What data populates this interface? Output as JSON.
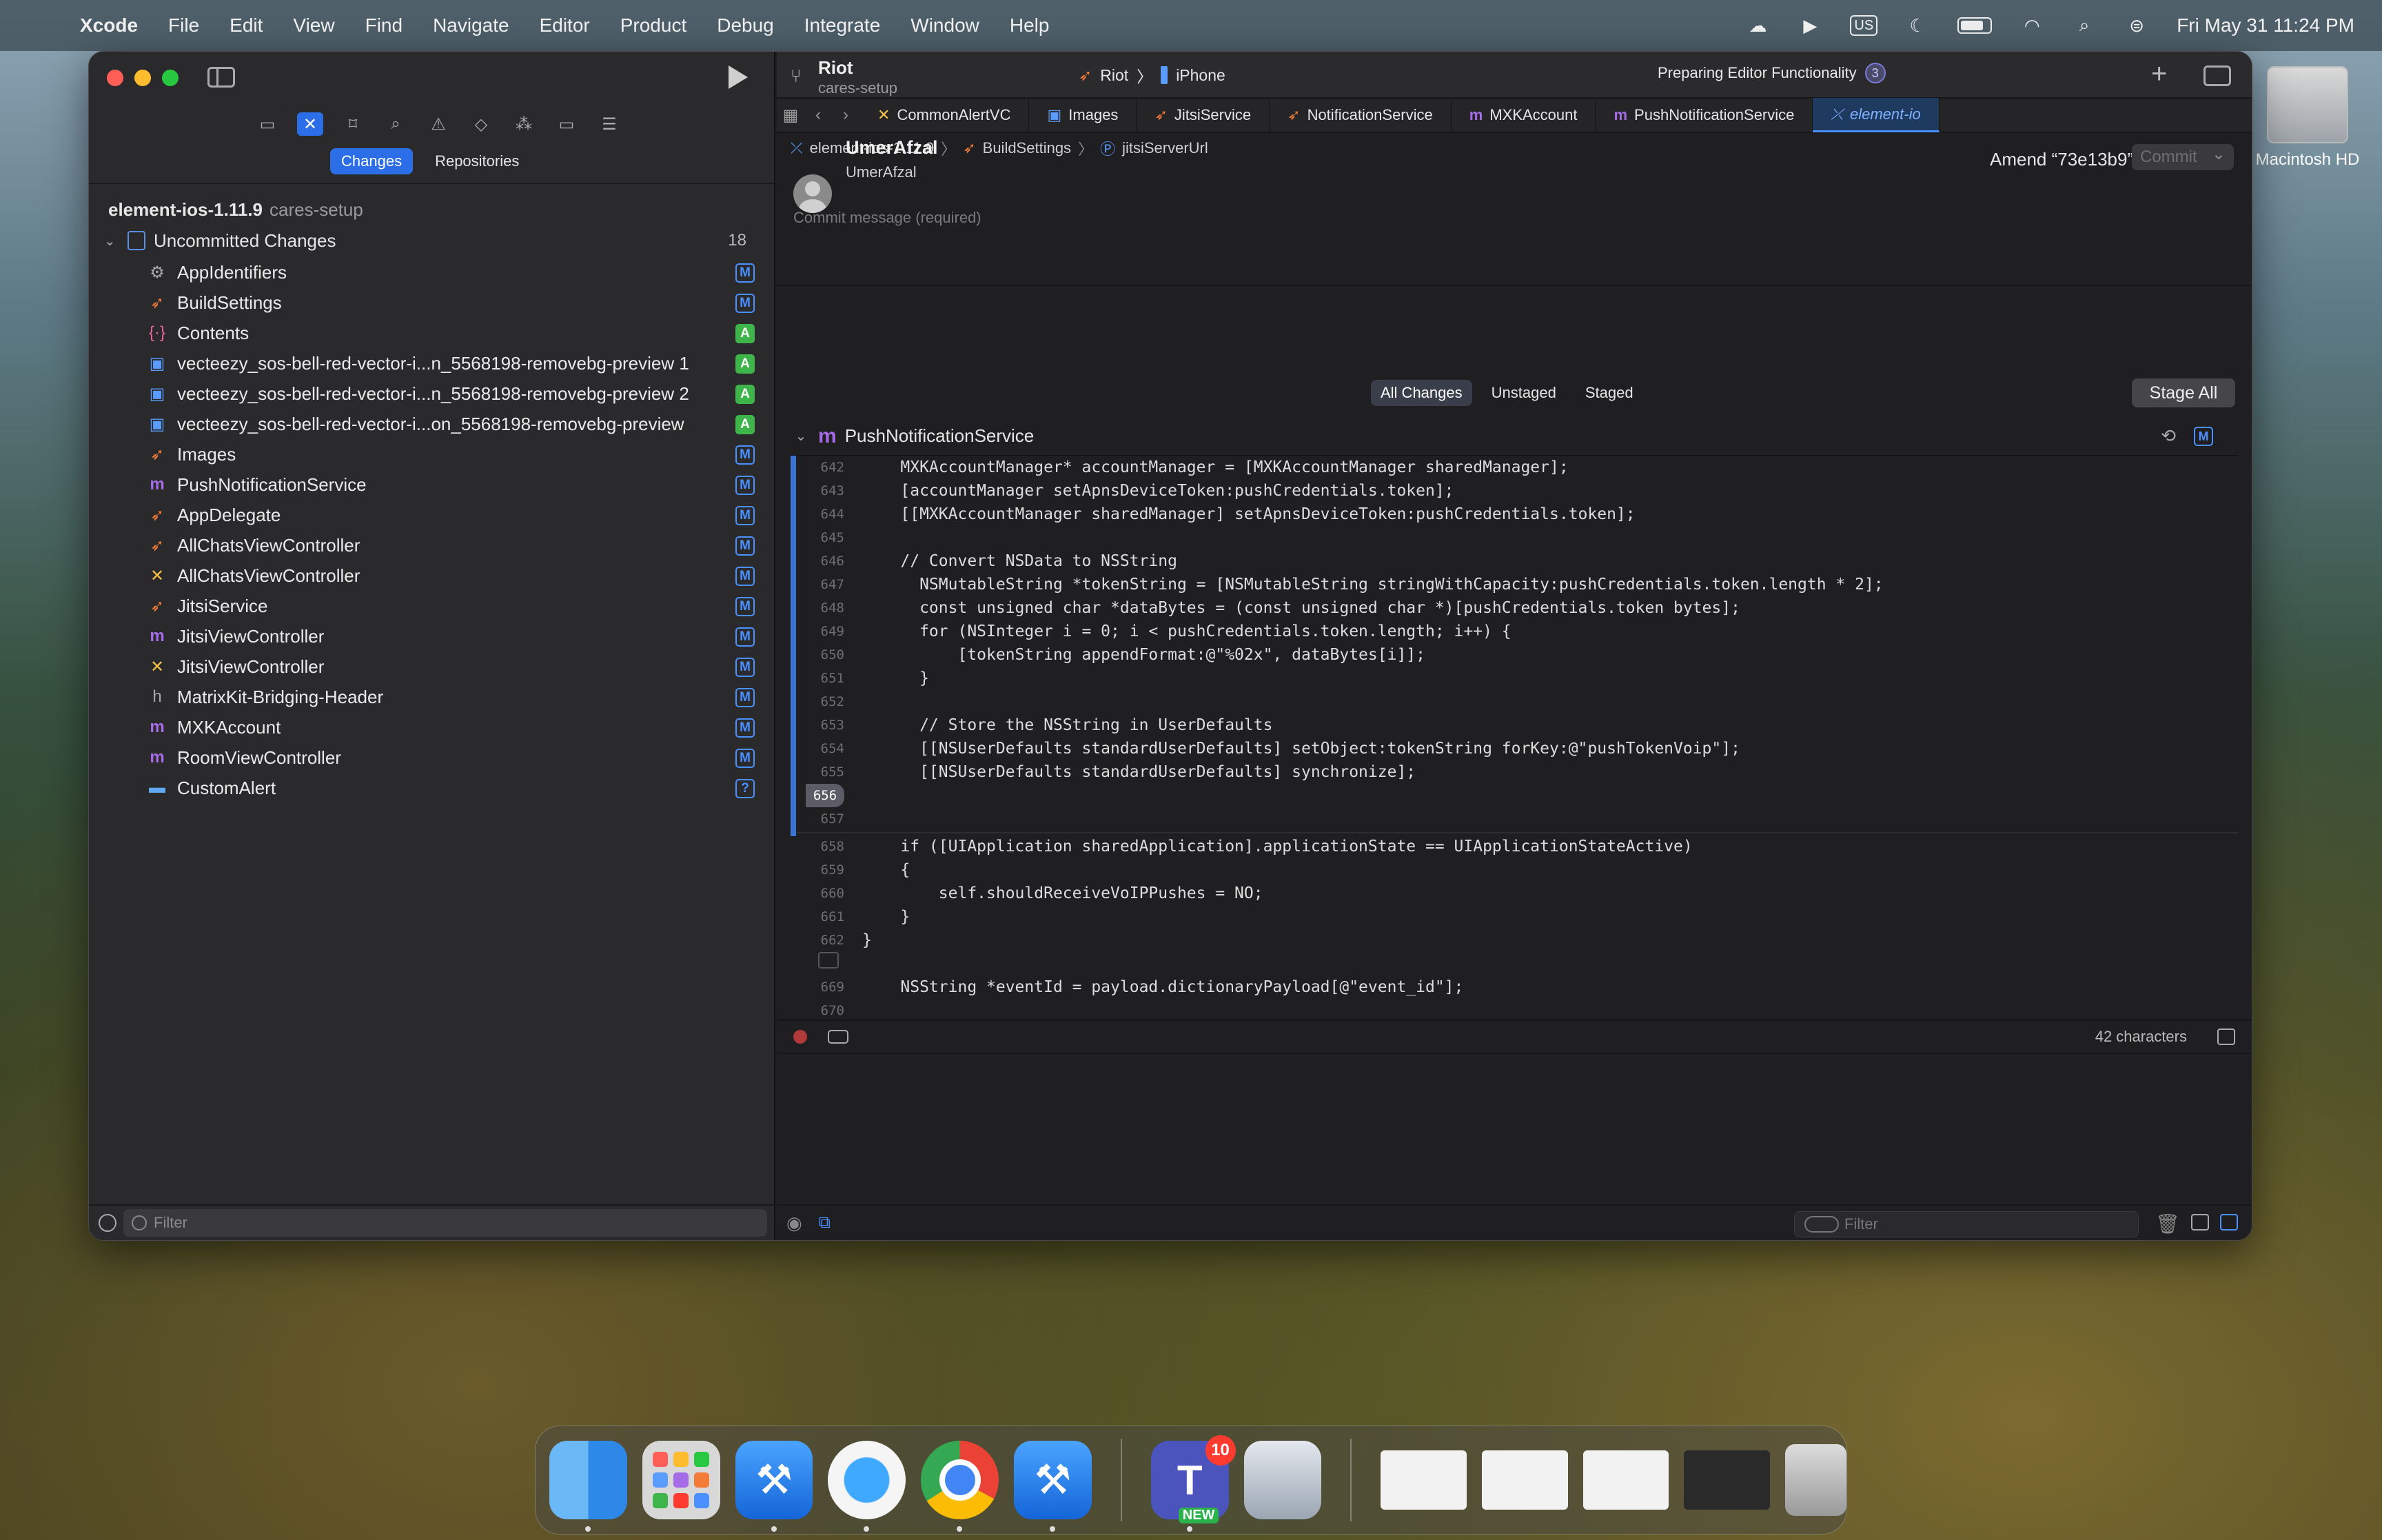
{
  "menubar": {
    "app_name": "Xcode",
    "items": [
      "File",
      "Edit",
      "View",
      "Find",
      "Navigate",
      "Editor",
      "Product",
      "Debug",
      "Integrate",
      "Window",
      "Help"
    ],
    "input_source": "US",
    "clock": "Fri May 31  11:24 PM",
    "battery_level": 0.7
  },
  "desktop": {
    "disk_label": "Macintosh HD"
  },
  "sidebar": {
    "segments": [
      "Changes",
      "Repositories"
    ],
    "active_segment": "Changes",
    "repo_name": "element-ios-1.11.9",
    "repo_branch": "cares-setup",
    "group_label": "Uncommitted Changes",
    "group_count": "18",
    "files": [
      {
        "name": "AppIdentifiers",
        "icon": "asset-icon",
        "status": "M"
      },
      {
        "name": "BuildSettings",
        "icon": "swift-file-icon",
        "status": "M"
      },
      {
        "name": "Contents",
        "icon": "json-file-icon",
        "status": "A"
      },
      {
        "name": "vecteezy_sos-bell-red-vector-i...n_5568198-removebg-preview 1",
        "icon": "image-file-icon",
        "status": "A"
      },
      {
        "name": "vecteezy_sos-bell-red-vector-i...n_5568198-removebg-preview 2",
        "icon": "image-file-icon",
        "status": "A"
      },
      {
        "name": "vecteezy_sos-bell-red-vector-i...on_5568198-removebg-preview",
        "icon": "image-file-icon",
        "status": "A"
      },
      {
        "name": "Images",
        "icon": "swift-file-icon",
        "status": "M"
      },
      {
        "name": "PushNotificationService",
        "icon": "objc-m-file-icon",
        "status": "M"
      },
      {
        "name": "AppDelegate",
        "icon": "swift-file-icon",
        "status": "M"
      },
      {
        "name": "AllChatsViewController",
        "icon": "swift-file-icon",
        "status": "M"
      },
      {
        "name": "AllChatsViewController",
        "icon": "xib-file-icon",
        "status": "M"
      },
      {
        "name": "JitsiService",
        "icon": "swift-file-icon",
        "status": "M"
      },
      {
        "name": "JitsiViewController",
        "icon": "objc-m-file-icon",
        "status": "M"
      },
      {
        "name": "JitsiViewController",
        "icon": "xib-file-icon",
        "status": "M"
      },
      {
        "name": "MatrixKit-Bridging-Header",
        "icon": "header-file-icon",
        "status": "M"
      },
      {
        "name": "MXKAccount",
        "icon": "objc-m-file-icon",
        "status": "M"
      },
      {
        "name": "RoomViewController",
        "icon": "objc-m-file-icon",
        "status": "M"
      },
      {
        "name": "CustomAlert",
        "icon": "folder-icon",
        "status": "?"
      }
    ],
    "filter_placeholder": "Filter"
  },
  "toolbar": {
    "project": "Riot",
    "branch": "cares-setup",
    "scheme": "Riot",
    "destination": "iPhone",
    "status": "Preparing Editor Functionality",
    "status_count": "3"
  },
  "tabs": [
    {
      "label": "CommonAlertVC",
      "icon": "xib-file-icon"
    },
    {
      "label": "Images",
      "icon": "image-file-icon"
    },
    {
      "label": "JitsiService",
      "icon": "swift-file-icon"
    },
    {
      "label": "NotificationService",
      "icon": "swift-file-icon"
    },
    {
      "label": "MXKAccount",
      "icon": "objc-m-file-icon"
    },
    {
      "label": "PushNotificationService",
      "icon": "objc-m-file-icon"
    },
    {
      "label": "element-io",
      "icon": "source-control-icon"
    }
  ],
  "breadcrumb": [
    "element-ios-1.11.9",
    "BuildSettings",
    "jitsiServerUrl"
  ],
  "commit": {
    "author_name": "UmerAfzal",
    "author_sub": "UmerAfzal",
    "amend_label": "Amend “73e13b9”",
    "amend_on": false,
    "commit_button": "Commit",
    "message_placeholder": "Commit message (required)",
    "filters": [
      "All Changes",
      "Unstaged",
      "Staged"
    ],
    "active_filter": "All Changes",
    "stage_all": "Stage All"
  },
  "diff": {
    "file_name": "PushNotificationService",
    "status": "M",
    "highlighted_line": "656",
    "lines": [
      {
        "n": "642",
        "t": "    MXKAccountManager* accountManager = [MXKAccountManager sharedManager];"
      },
      {
        "n": "643",
        "t": "    [accountManager setApnsDeviceToken:pushCredentials.token];"
      },
      {
        "n": "644",
        "t": "    [[MXKAccountManager sharedManager] setApnsDeviceToken:pushCredentials.token];"
      },
      {
        "n": "645",
        "t": ""
      },
      {
        "n": "646",
        "t": "    // Convert NSData to NSString"
      },
      {
        "n": "647",
        "t": "      NSMutableString *tokenString = [NSMutableString stringWithCapacity:pushCredentials.token.length * 2];"
      },
      {
        "n": "648",
        "t": "      const unsigned char *dataBytes = (const unsigned char *)[pushCredentials.token bytes];"
      },
      {
        "n": "649",
        "t": "      for (NSInteger i = 0; i < pushCredentials.token.length; i++) {"
      },
      {
        "n": "650",
        "t": "          [tokenString appendFormat:@\"%02x\", dataBytes[i]];"
      },
      {
        "n": "651",
        "t": "      }"
      },
      {
        "n": "652",
        "t": ""
      },
      {
        "n": "653",
        "t": "      // Store the NSString in UserDefaults"
      },
      {
        "n": "654",
        "t": "      [[NSUserDefaults standardUserDefaults] setObject:tokenString forKey:@\"pushTokenVoip\"];"
      },
      {
        "n": "655",
        "t": "      [[NSUserDefaults standardUserDefaults] synchronize];"
      },
      {
        "n": "656",
        "t": ""
      },
      {
        "n": "657",
        "t": ""
      },
      {
        "n": "658",
        "t": "    if ([UIApplication sharedApplication].applicationState == UIApplicationStateActive)"
      },
      {
        "n": "659",
        "t": "    {"
      },
      {
        "n": "660",
        "t": "        self.shouldReceiveVoIPPushes = NO;"
      },
      {
        "n": "661",
        "t": "    }"
      },
      {
        "n": "662",
        "t": "}"
      },
      {
        "n": "",
        "t": ""
      },
      {
        "n": "669",
        "t": "    NSString *eventId = payload.dictionaryPayload[@\"event_id\"];"
      },
      {
        "n": "670",
        "t": ""
      }
    ],
    "char_count": "42 characters"
  },
  "bottom": {
    "filter_placeholder": "Filter"
  },
  "dock": {
    "apps": [
      "Finder",
      "Launchpad",
      "Xcode",
      "Safari",
      "Google Chrome",
      "Xcode Beta",
      "Microsoft Teams",
      "Preview"
    ],
    "teams_badge": "10",
    "teams_new": "NEW"
  },
  "colors": {
    "accent": "#2b6ee8",
    "added": "#3db54a",
    "modified": "#4a90ff",
    "keyword": "#fc5fa3",
    "string": "#fc6a5d",
    "comment": "#7f8c98"
  }
}
